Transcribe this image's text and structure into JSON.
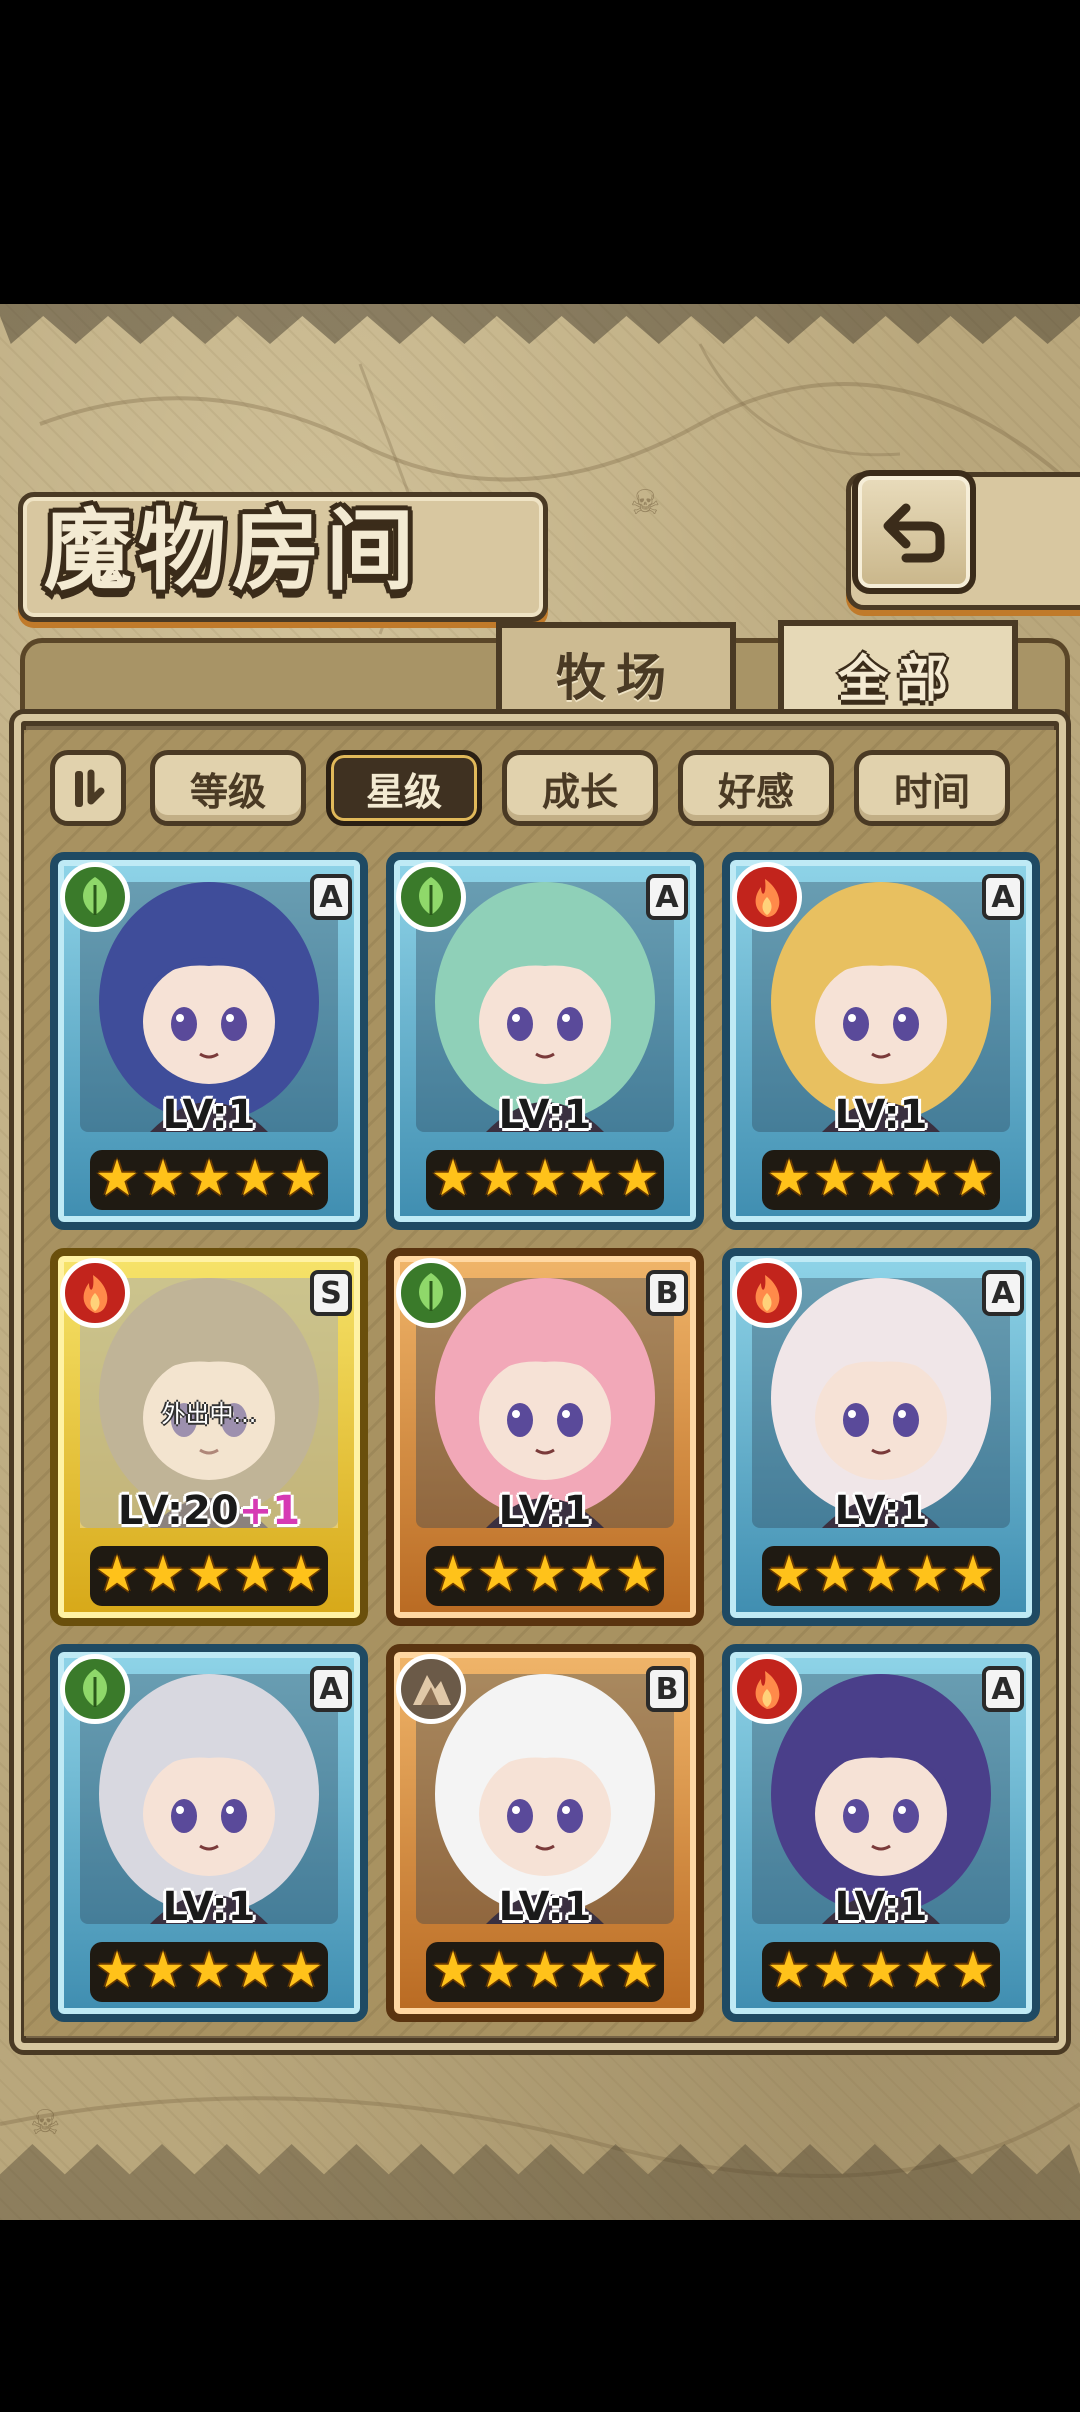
{
  "title": "魔物房间",
  "tabs": [
    {
      "label": "牧场",
      "active": false
    },
    {
      "label": "全部",
      "active": true
    }
  ],
  "sort_toggle_icon": "sort-order-icon",
  "sort_buttons": [
    {
      "label": "等级",
      "active": false
    },
    {
      "label": "星级",
      "active": true
    },
    {
      "label": "成长",
      "active": false
    },
    {
      "label": "好感",
      "active": false
    },
    {
      "label": "时间",
      "active": false
    }
  ],
  "monsters": [
    {
      "element": "leaf",
      "rank": "A",
      "level": "LV:1",
      "plus": "",
      "stars": 5,
      "frame": "blue",
      "status": "",
      "hair": "#3f4d9a"
    },
    {
      "element": "leaf",
      "rank": "A",
      "level": "LV:1",
      "plus": "",
      "stars": 5,
      "frame": "blue",
      "status": "",
      "hair": "#8fd0b8"
    },
    {
      "element": "fire",
      "rank": "A",
      "level": "LV:1",
      "plus": "",
      "stars": 5,
      "frame": "blue",
      "status": "",
      "hair": "#e8c060"
    },
    {
      "element": "fire",
      "rank": "S",
      "level": "LV:20",
      "plus": "+1",
      "stars": 5,
      "frame": "gold",
      "status": "外出中...",
      "hair": "#9a8a70"
    },
    {
      "element": "leaf",
      "rank": "B",
      "level": "LV:1",
      "plus": "",
      "stars": 5,
      "frame": "bronze",
      "status": "",
      "hair": "#f2a8b8"
    },
    {
      "element": "fire",
      "rank": "A",
      "level": "LV:1",
      "plus": "",
      "stars": 5,
      "frame": "blue",
      "status": "",
      "hair": "#f0e6e8"
    },
    {
      "element": "leaf",
      "rank": "A",
      "level": "LV:1",
      "plus": "",
      "stars": 5,
      "frame": "blue",
      "status": "",
      "hair": "#d8d8e0"
    },
    {
      "element": "earth",
      "rank": "B",
      "level": "LV:1",
      "plus": "",
      "stars": 5,
      "frame": "bronze",
      "status": "",
      "hair": "#f4f4f4"
    },
    {
      "element": "fire",
      "rank": "A",
      "level": "LV:1",
      "plus": "",
      "stars": 5,
      "frame": "blue",
      "status": "",
      "hair": "#4a3f8a"
    }
  ],
  "colors": {
    "background": "#b9a77c",
    "frame_blue": "#3f8db0",
    "frame_gold": "#d7a818",
    "frame_bronze": "#b96a22",
    "star": "#ffc21a"
  }
}
